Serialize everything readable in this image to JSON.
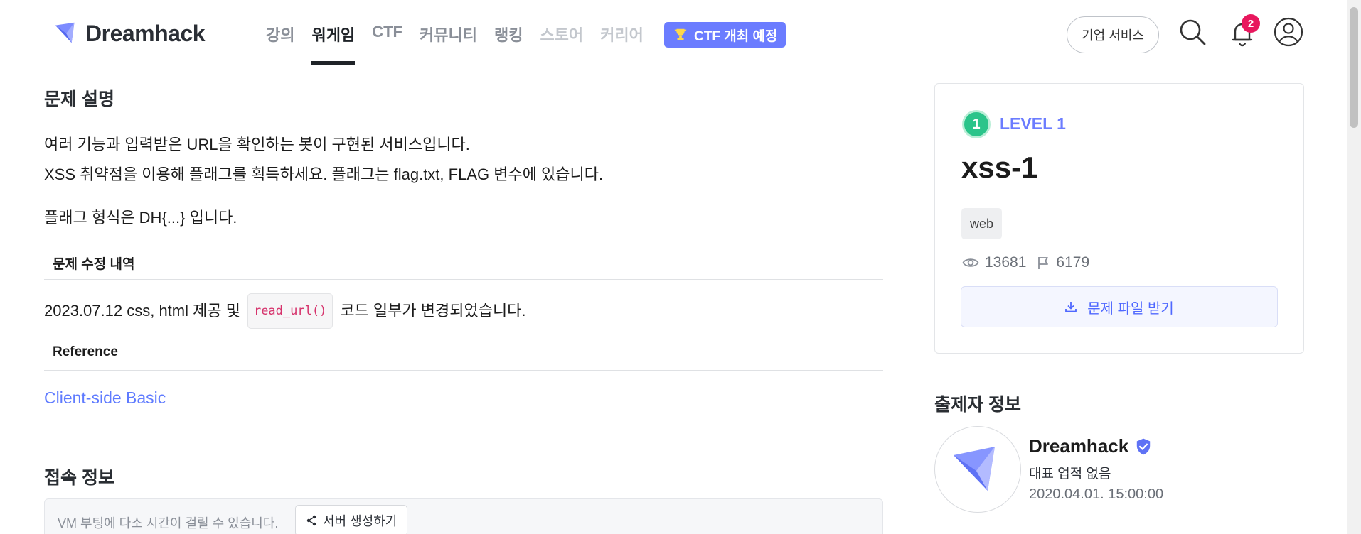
{
  "header": {
    "logo_text": "Dreamhack",
    "nav": [
      {
        "label": "강의",
        "state": "normal"
      },
      {
        "label": "워게임",
        "state": "active"
      },
      {
        "label": "CTF",
        "state": "normal"
      },
      {
        "label": "커뮤니티",
        "state": "normal"
      },
      {
        "label": "랭킹",
        "state": "normal"
      },
      {
        "label": "스토어",
        "state": "dim"
      },
      {
        "label": "커리어",
        "state": "dim"
      }
    ],
    "ctf_badge": "CTF 개최 예정",
    "business_button": "기업 서비스",
    "notification_count": "2",
    "accent_color": "#6b7cff"
  },
  "description": {
    "title": "문제 설명",
    "line1": "여러 기능과 입력받은 URL을 확인하는 봇이 구현된 서비스입니다.",
    "line2": "XSS 취약점을 이용해 플래그를 획득하세요. 플래그는 flag.txt, FLAG 변수에 있습니다.",
    "flag_format": "플래그 형식은 DH{...} 입니다.",
    "changes_title": "문제 수정 내역",
    "change_prefix": "2023.07.12 css, html 제공 및",
    "change_code": "read_url()",
    "change_suffix": "코드 일부가 변경되었습니다.",
    "reference_title": "Reference",
    "reference_link": "Client-side Basic"
  },
  "connection": {
    "title": "접속 정보",
    "vm_notice": "VM 부팅에 다소 시간이 걸릴 수 있습니다.",
    "create_server": "서버 생성하기"
  },
  "challenge": {
    "level_number": "1",
    "level_label": "LEVEL 1",
    "name": "xss-1",
    "tag": "web",
    "views": "13681",
    "solves": "6179",
    "download": "문제 파일 받기"
  },
  "author": {
    "section_title": "출제자 정보",
    "name": "Dreamhack",
    "achievement": "대표 업적 없음",
    "date": "2020.04.01. 15:00:00"
  }
}
